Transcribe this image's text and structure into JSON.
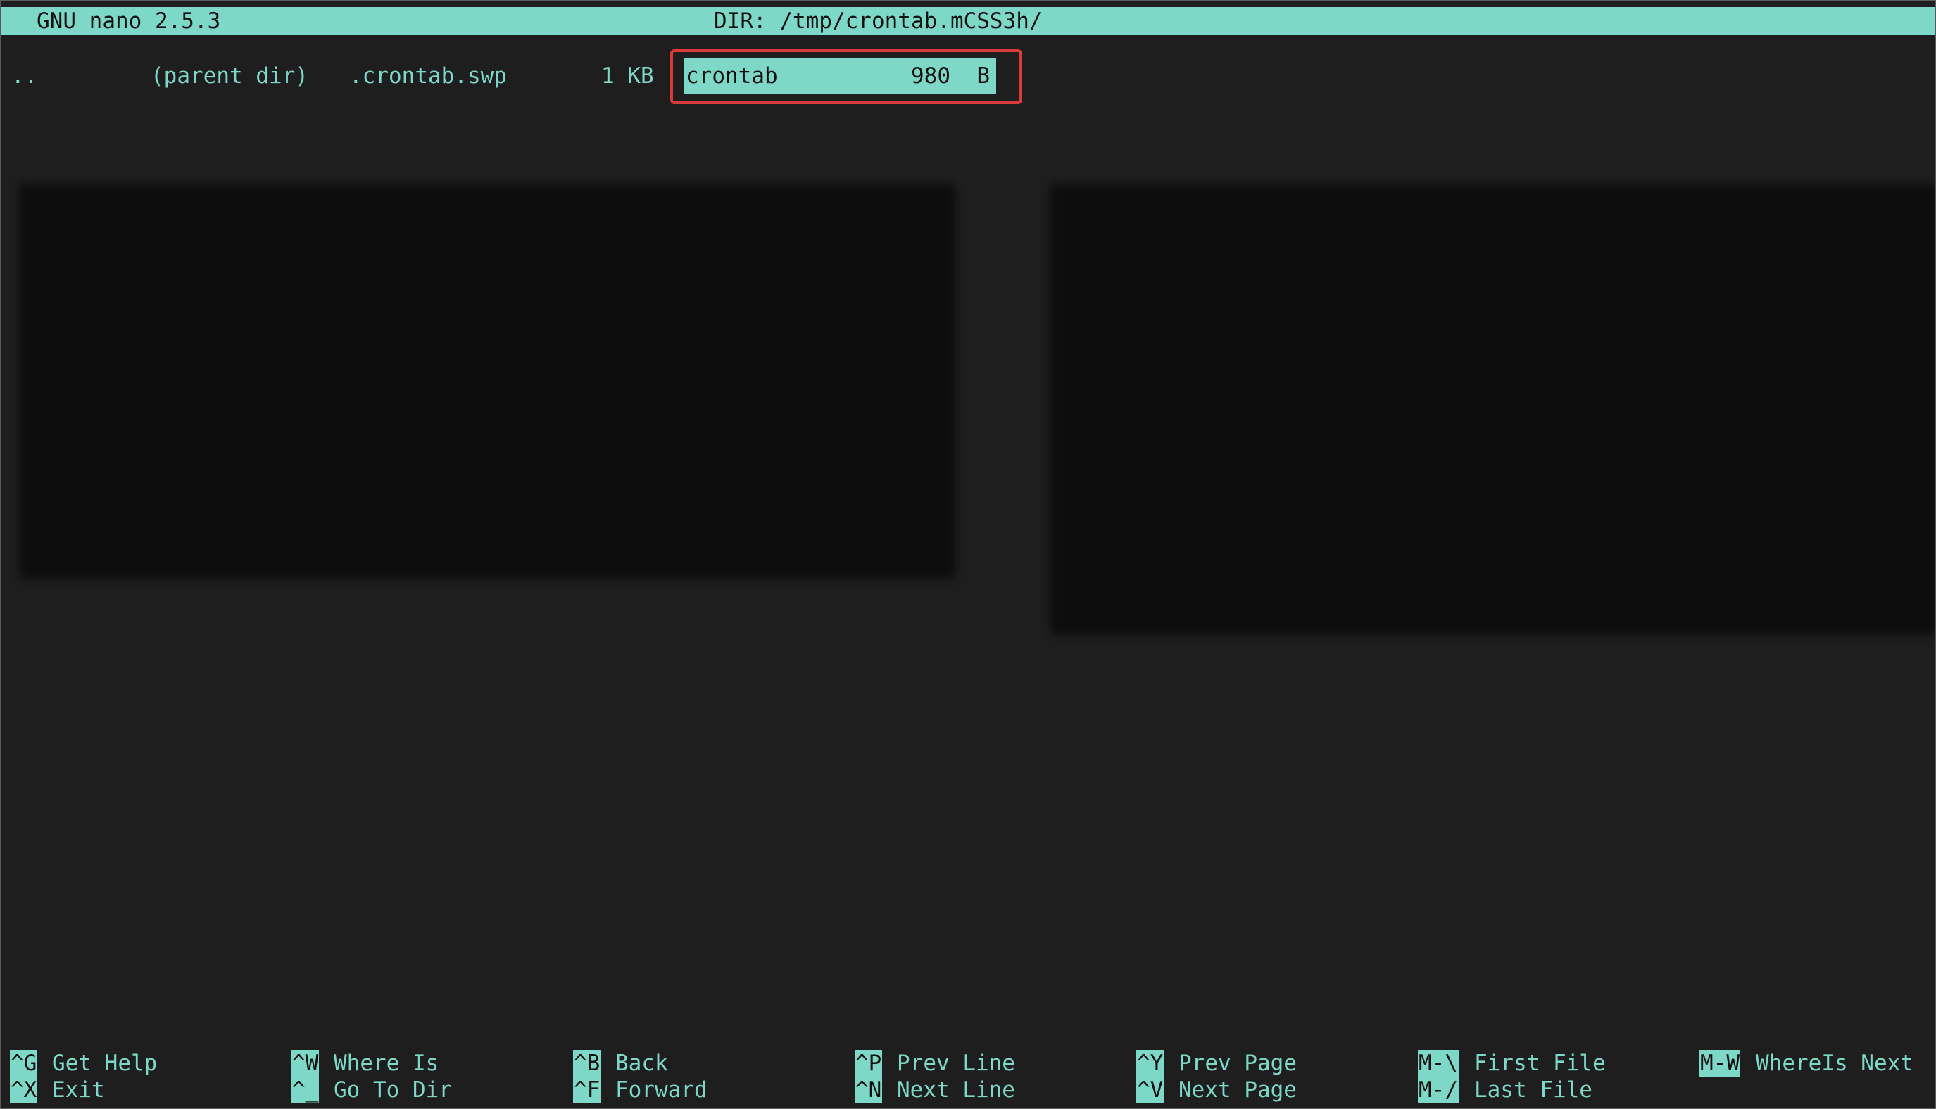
{
  "colors": {
    "accent": "#7ed8c8",
    "background": "#1e1e1e",
    "highlight_box": "#d93a3a"
  },
  "title_bar": {
    "app": "GNU nano 2.5.3",
    "dir": "DIR: /tmp/crontab.mCSS3h/"
  },
  "browser": {
    "entries": [
      {
        "name": "..",
        "size": "(parent dir)"
      },
      {
        "name": ".crontab.swp",
        "size": "1 KB"
      },
      {
        "name": "crontab",
        "size": "980  B",
        "selected": true
      }
    ]
  },
  "shortcuts": [
    {
      "key": "^G",
      "label": "Get Help"
    },
    {
      "key": "^X",
      "label": "Exit"
    },
    {
      "key": "^W",
      "label": "Where Is"
    },
    {
      "key": "^_",
      "label": "Go To Dir"
    },
    {
      "key": "^B",
      "label": "Back"
    },
    {
      "key": "^F",
      "label": "Forward"
    },
    {
      "key": "^P",
      "label": "Prev Line"
    },
    {
      "key": "^N",
      "label": "Next Line"
    },
    {
      "key": "^Y",
      "label": "Prev Page"
    },
    {
      "key": "^V",
      "label": "Next Page"
    },
    {
      "key": "M-\\",
      "label": "First File"
    },
    {
      "key": "M-/",
      "label": "Last File"
    },
    {
      "key": "M-W",
      "label": "WhereIs Next"
    }
  ]
}
